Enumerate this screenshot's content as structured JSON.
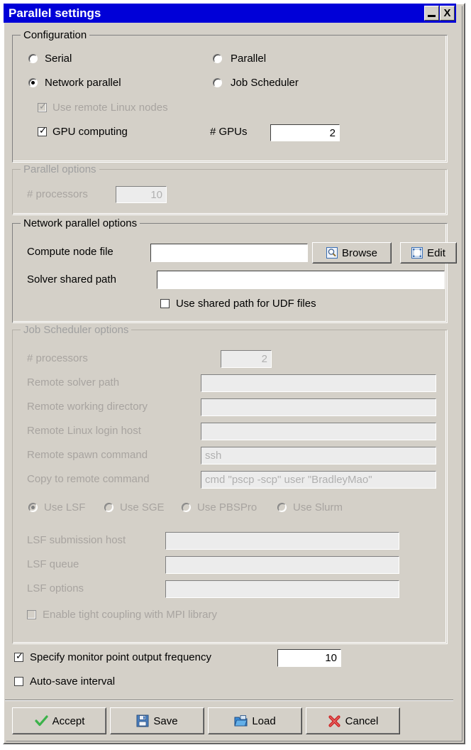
{
  "window": {
    "title": "Parallel settings",
    "titlebar_color": "#0000d8",
    "face_color": "#d4d0c8",
    "minimize_label": "_",
    "close_label": "X"
  },
  "configuration": {
    "group_label": "Configuration",
    "radios": [
      {
        "label": "Serial",
        "checked": false,
        "disabled": false
      },
      {
        "label": "Parallel",
        "checked": false,
        "disabled": false
      },
      {
        "label": "Network parallel",
        "checked": true,
        "disabled": false
      },
      {
        "label": "Job Scheduler",
        "checked": false,
        "disabled": false
      }
    ],
    "remote_linux_nodes": {
      "label": "Use remote Linux nodes",
      "checked": true,
      "disabled": true
    },
    "gpu_computing": {
      "label": "GPU computing",
      "checked": true,
      "disabled": false
    },
    "gpus": {
      "label": "# GPUs",
      "value": "2"
    }
  },
  "parallel_options": {
    "group_label": "Parallel options",
    "disabled": true,
    "processors": {
      "label": "# processors",
      "value": "10"
    }
  },
  "network_parallel_options": {
    "group_label": "Network parallel options",
    "compute_node_file": {
      "label": "Compute node file",
      "value": "",
      "placeholder": ""
    },
    "browse_button": "Browse",
    "edit_button": "Edit",
    "solver_shared_path": {
      "label": "Solver shared path",
      "value": "",
      "placeholder": ""
    },
    "use_shared_path_udf": {
      "label": "Use shared path for UDF files",
      "checked": false
    }
  },
  "job_scheduler_options": {
    "group_label": "Job Scheduler options",
    "disabled": true,
    "fields": [
      {
        "label": "# processors",
        "value": "2",
        "numeric": true
      },
      {
        "label": "Remote solver path",
        "value": "",
        "numeric": false
      },
      {
        "label": "Remote working directory",
        "value": "",
        "numeric": false
      },
      {
        "label": "Remote Linux login host",
        "value": "",
        "numeric": false
      },
      {
        "label": "Remote spawn command",
        "value": "ssh",
        "numeric": false
      },
      {
        "label": "Copy to remote command",
        "value": "cmd \"pscp -scp\" user \"BradleyMao\"",
        "numeric": false
      }
    ],
    "scheduler_radios": [
      {
        "label": "Use LSF",
        "checked": true
      },
      {
        "label": "Use SGE",
        "checked": false
      },
      {
        "label": "Use PBSPro",
        "checked": false
      },
      {
        "label": "Use Slurm",
        "checked": false
      }
    ],
    "lsf_fields": [
      {
        "label": "LSF submission host",
        "value": ""
      },
      {
        "label": "LSF queue",
        "value": ""
      },
      {
        "label": "LSF options",
        "value": ""
      }
    ],
    "tight_coupling": {
      "label": "Enable tight coupling with MPI library",
      "checked": false
    }
  },
  "bottom_options": {
    "monitor_frequency": {
      "label": "Specify monitor point output frequency",
      "checked": true,
      "value": "10"
    },
    "auto_save": {
      "label": "Auto-save interval",
      "checked": false
    }
  },
  "buttons": {
    "accept": {
      "label": "Accept",
      "icon": "green-check-icon",
      "color": "#3bb24a"
    },
    "save": {
      "label": "Save",
      "icon": "floppy-disk-icon",
      "color": "#3a6fb5"
    },
    "load": {
      "label": "Load",
      "icon": "folder-icon",
      "color": "#2a6fc0"
    },
    "cancel": {
      "label": "Cancel",
      "icon": "red-x-icon",
      "color": "#cc2222"
    }
  }
}
